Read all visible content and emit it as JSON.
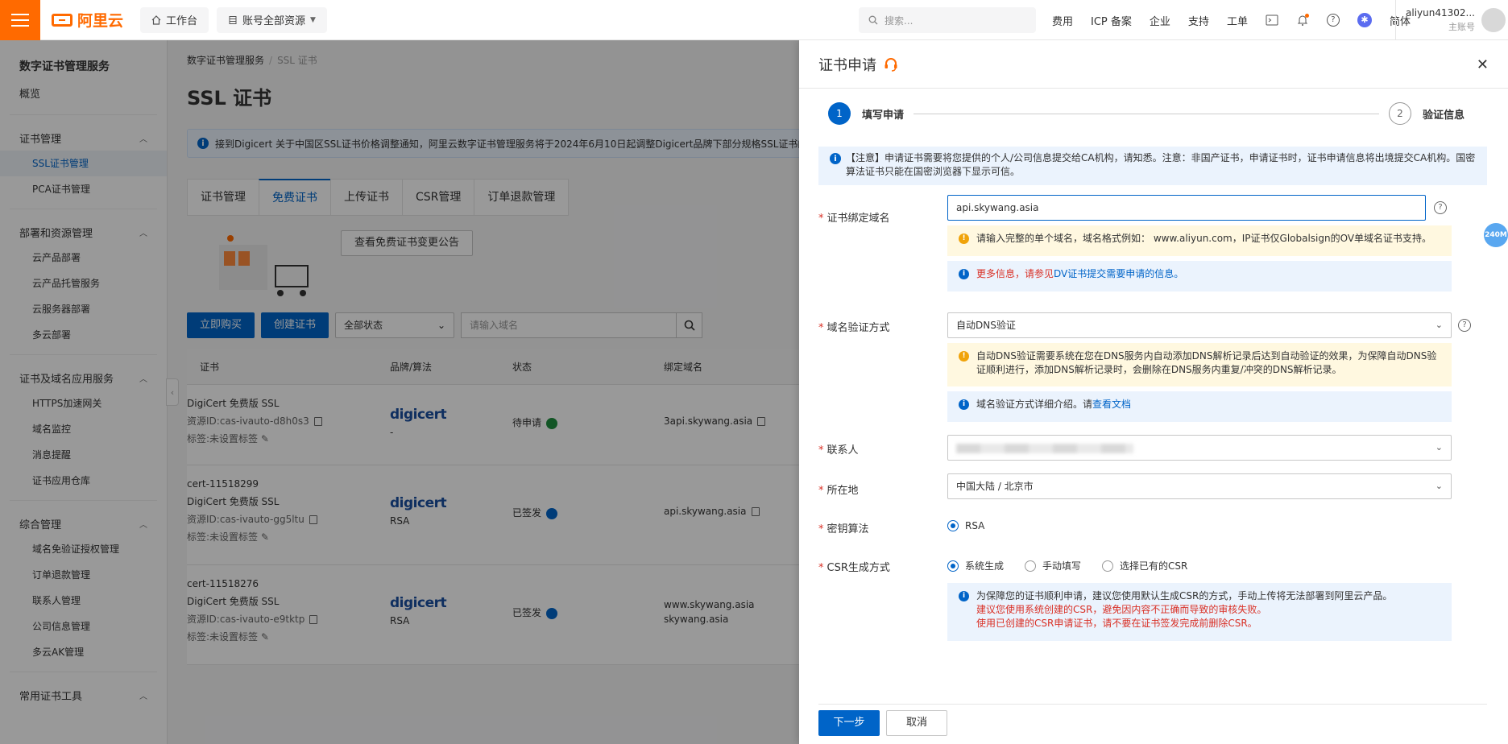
{
  "topbar": {
    "logo": "阿里云",
    "workbench": "工作台",
    "resources": "账号全部资源",
    "search_placeholder": "搜索...",
    "links": [
      "费用",
      "ICP 备案",
      "企业",
      "支持",
      "工单"
    ],
    "lang": "简体",
    "user_name": "aliyun41302...",
    "user_role": "主账号"
  },
  "sidebar": {
    "title": "数字证书管理服务",
    "overview": "概览",
    "sections": [
      {
        "label": "证书管理",
        "items": [
          "SSL证书管理",
          "PCA证书管理"
        ]
      },
      {
        "label": "部署和资源管理",
        "items": [
          "云产品部署",
          "云产品托管服务",
          "云服务器部署",
          "多云部署"
        ]
      },
      {
        "label": "证书及域名应用服务",
        "items": [
          "HTTPS加速网关",
          "域名监控",
          "消息提醒",
          "证书应用仓库"
        ]
      },
      {
        "label": "综合管理",
        "items": [
          "域名免验证授权管理",
          "订单退款管理",
          "联系人管理",
          "公司信息管理",
          "多云AK管理"
        ]
      },
      {
        "label": "常用证书工具",
        "items": []
      }
    ]
  },
  "main": {
    "breadcrumb": [
      "数字证书管理服务",
      "SSL 证书"
    ],
    "title": "SSL 证书",
    "notice": "接到Digicert 关于中国区SSL证书价格调整通知，阿里云数字证书管理服务将于2024年6月10日起调整Digicert品牌下部分规格SSL证书的售价",
    "tabs": [
      "证书管理",
      "免费证书",
      "上传证书",
      "CSR管理",
      "订单退款管理"
    ],
    "promo_button": "查看免费证书变更公告",
    "buy_button": "立即购买",
    "create_button": "创建证书",
    "status_filter": "全部状态",
    "search_placeholder": "请输入域名",
    "columns": [
      "证书",
      "品牌/算法",
      "状态",
      "绑定域名"
    ],
    "rows": [
      {
        "name": "",
        "type": "DigiCert 免费版 SSL",
        "id": "资源ID:cas-ivauto-d8h0s3",
        "tags": "标签:未设置标签",
        "brand": "digicert",
        "algo": "-",
        "status": "待申请",
        "domain": "3api.skywang.asia",
        "domain2": ""
      },
      {
        "name": "cert-11518299",
        "type": "DigiCert 免费版 SSL",
        "id": "资源ID:cas-ivauto-gg5ltu",
        "tags": "标签:未设置标签",
        "brand": "digicert",
        "algo": "RSA",
        "status": "已签发",
        "domain": "api.skywang.asia",
        "domain2": ""
      },
      {
        "name": "cert-11518276",
        "type": "DigiCert 免费版 SSL",
        "id": "资源ID:cas-ivauto-e9tktp",
        "tags": "标签:未设置标签",
        "brand": "digicert",
        "algo": "RSA",
        "status": "已签发",
        "domain": "www.skywang.asia",
        "domain2": "skywang.asia"
      }
    ]
  },
  "drawer": {
    "title": "证书申请",
    "steps": [
      "填写申请",
      "验证信息"
    ],
    "note": "【注意】申请证书需要将您提供的个人/公司信息提交给CA机构，请知悉。注意：非国产证书，申请证书时，证书申请信息将出境提交CA机构。国密算法证书只能在国密浏览器下显示可信。",
    "fields": {
      "domain_label": "证书绑定域名",
      "domain_value": "api.skywang.asia",
      "domain_warn": "请输入完整的单个域名，域名格式例如： www.aliyun.com，IP证书仅Globalsign的OV单域名证书支持。",
      "domain_info_red": "更多信息，请参见",
      "domain_info_link": "DV证书提交需要申请的信息。",
      "verify_label": "域名验证方式",
      "verify_value": "自动DNS验证",
      "verify_warn": "自动DNS验证需要系统在您在DNS服务内自动添加DNS解析记录后达到自动验证的效果，为保障自动DNS验证顺利进行，添加DNS解析记录时，会删除在DNS服务内重复/冲突的DNS解析记录。",
      "verify_info": "域名验证方式详细介绍。请",
      "verify_info_link": "查看文档",
      "contact_label": "联系人",
      "location_label": "所在地",
      "location_value": "中国大陆 / 北京市",
      "algo_label": "密钥算法",
      "algo_value": "RSA",
      "csr_label": "CSR生成方式",
      "csr_options": [
        "系统生成",
        "手动填写",
        "选择已有的CSR"
      ],
      "csr_info_1": "为保障您的证书顺利申请，建议您使用默认生成CSR的方式，手动上传将无法部署到阿里云产品。",
      "csr_info_2": "建议您使用系统创建的CSR，避免因内容不正确而导致的审核失败。",
      "csr_info_3": "使用已创建的CSR申请证书，请不要在证书签发完成前删除CSR。"
    },
    "next_button": "下一步",
    "cancel_button": "取消"
  },
  "float_badge": "240M",
  "colors": {
    "brand": "#ff6a00",
    "primary": "#0064c8",
    "danger": "#d93026",
    "warn_bg": "#fff8e0",
    "info_bg": "#ebf3fd"
  }
}
